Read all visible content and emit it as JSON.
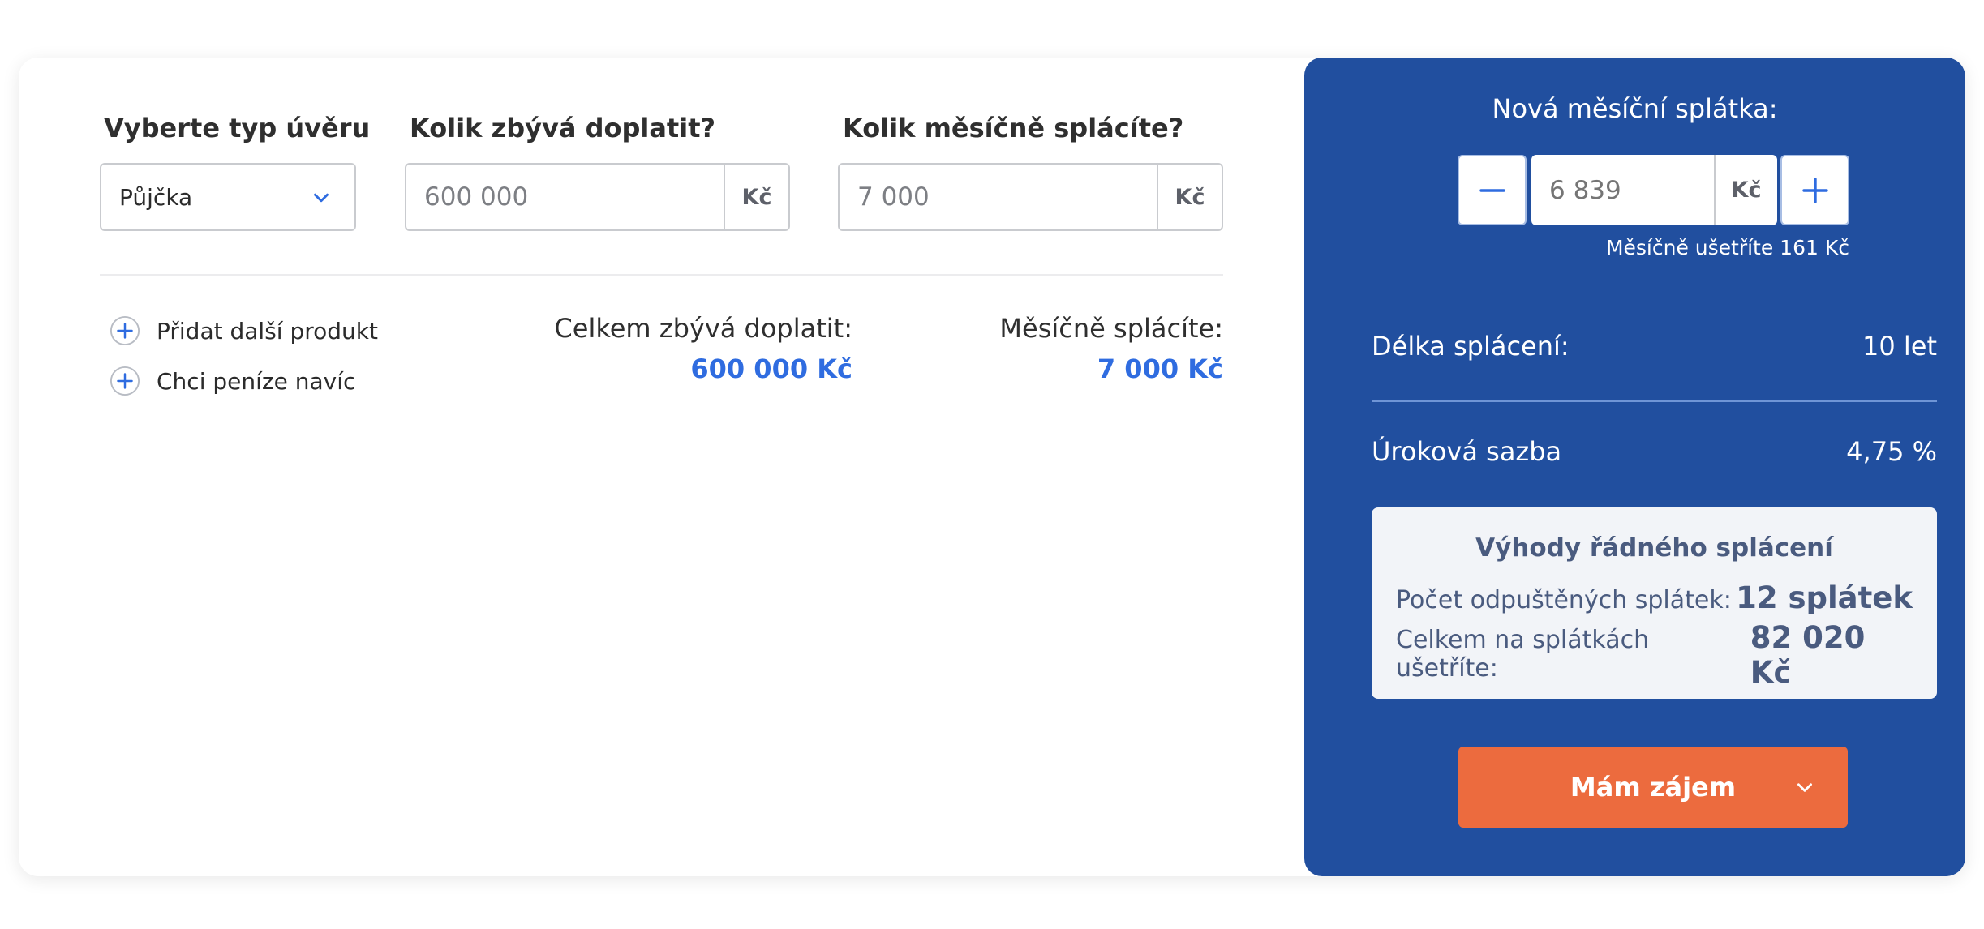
{
  "form": {
    "loan_type_label": "Vyberte typ úvěru",
    "loan_type_value": "Půjčka",
    "remaining_label": "Kolik zbývá doplatit?",
    "remaining_placeholder": "600 000",
    "monthly_label": "Kolik měsíčně splácíte?",
    "monthly_placeholder": "7 000",
    "currency": "Kč"
  },
  "links": {
    "add_product": "Přidat další produkt",
    "extra_money": "Chci peníze navíc"
  },
  "summary": {
    "total_label": "Celkem zbývá doplatit:",
    "total_value": "600 000 Kč",
    "monthly_label": "Měsíčně splácíte:",
    "monthly_value": "7 000 Kč"
  },
  "panel": {
    "new_payment_label": "Nová měsíční splátka:",
    "new_payment_value": "6 839",
    "currency": "Kč",
    "savings_note": "Měsíčně ušetříte 161 Kč",
    "duration_label": "Délka splácení:",
    "duration_value": "10 let",
    "rate_label": "Úroková sazba",
    "rate_value": "4,75 %",
    "benefits": {
      "title": "Výhody řádného splácení",
      "forgiven_label": "Počet odpuštěných splátek:",
      "forgiven_value": "12 splátek",
      "saved_label": "Celkem na splátkách ušetříte:",
      "saved_value": "82 020 Kč"
    },
    "cta_label": "Mám zájem"
  },
  "icons": {
    "select_chevron": "chevron-down-icon",
    "add": "plus-circle-icon",
    "minus": "minus-icon",
    "plus": "plus-icon",
    "cta_chevron": "chevron-down-icon"
  },
  "colors": {
    "panel_bg": "#214f9f",
    "accent_blue": "#2f6ce0",
    "cta_orange": "#ec6b3e",
    "benefits_bg": "#f2f4f8"
  }
}
